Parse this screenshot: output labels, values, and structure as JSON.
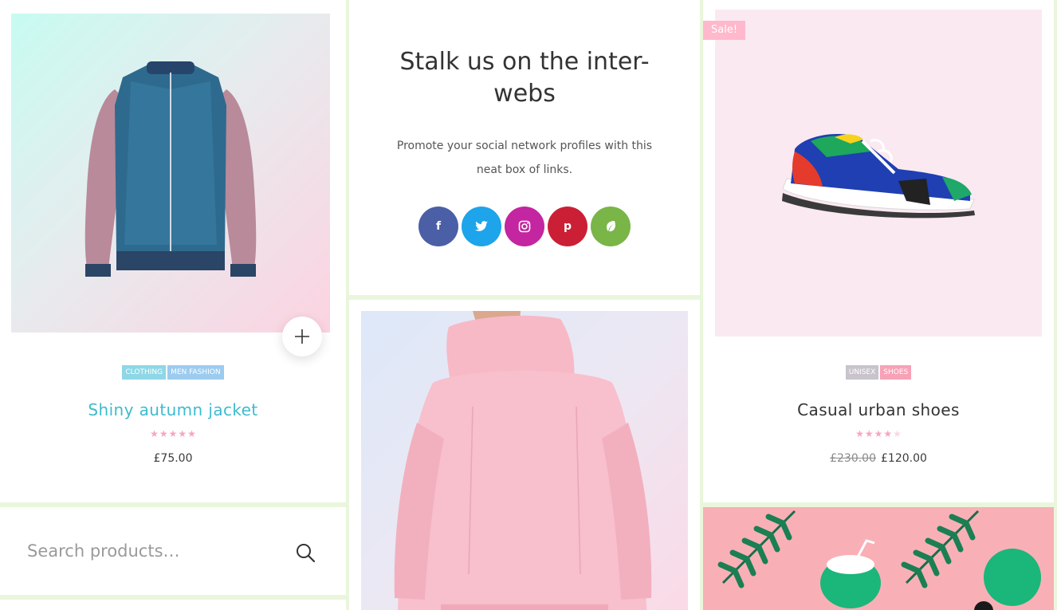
{
  "colors": {
    "accent": "#3dbbd0",
    "tag_blue": "#8ed7e6",
    "tag_light_blue": "#9ccbef",
    "tag_grey": "#c8c3cc",
    "tag_pink": "#f7a2b6",
    "star": "#f6a6bd",
    "star_empty": "#f7d9e3",
    "facebook": "#4b5fa6",
    "twitter": "#1da4eb",
    "instagram": "#c425a0",
    "pinterest": "#cb1f36",
    "houzz": "#7ab547",
    "banner_green": "#1bb67a"
  },
  "product_left": {
    "image_icon": "jacket-image",
    "quick_view_icon": "plus-icon",
    "categories": [
      "CLOTHING",
      "MEN FASHION"
    ],
    "title": "Shiny autumn jacket",
    "rating": 5,
    "rating_max": 5,
    "price": "£75.00"
  },
  "search": {
    "placeholder": "Search products…",
    "icon": "search-icon"
  },
  "social": {
    "title": "Stalk us on the inter-webs",
    "text": "Promote your social network profiles with this neat box of links.",
    "links": [
      {
        "name": "facebook",
        "glyph": "f"
      },
      {
        "name": "twitter",
        "glyph": "t"
      },
      {
        "name": "instagram",
        "glyph": "◎"
      },
      {
        "name": "pinterest",
        "glyph": "p"
      },
      {
        "name": "houzz",
        "glyph": "❦"
      }
    ]
  },
  "product_middle": {
    "image_icon": "hoodie-image"
  },
  "product_right": {
    "badge": "Sale!",
    "image_icon": "sneaker-image",
    "categories": [
      "UNISEX",
      "SHOES"
    ],
    "title": "Casual urban shoes",
    "rating": 4,
    "rating_max": 5,
    "old_price": "£230.00",
    "price": "£120.00"
  },
  "banner": {
    "image_icon": "tropical-banner-image"
  }
}
